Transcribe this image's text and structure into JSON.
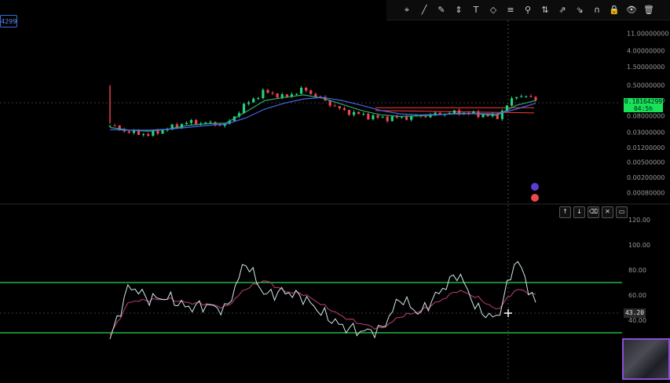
{
  "chart_data": [
    {
      "type": "line",
      "subtype": "candlestick-with-moving-averages",
      "title": "",
      "xlabel": "",
      "ylabel": "",
      "y_scale": "log",
      "ylim": [
        0.00045,
        20
      ],
      "y_ticks": [
        "11.00000000",
        "4.00000000",
        "1.50000000",
        "0.50000000",
        "0.20000000",
        "0.08000000",
        "0.03000000",
        "0.01200000",
        "0.00500000",
        "0.00200000",
        "0.00080000"
      ],
      "x": [
        0,
        6,
        12,
        18,
        24,
        30,
        36,
        42,
        48,
        54,
        60,
        66,
        72,
        78,
        84,
        90,
        96,
        102,
        108,
        114,
        120,
        126,
        132
      ],
      "series": [
        {
          "values": [
            0.045,
            0.03,
            0.026,
            0.038,
            0.055,
            0.052,
            0.046,
            0.16,
            0.35,
            0.24,
            0.4,
            0.21,
            0.11,
            0.085,
            0.07,
            0.072,
            0.078,
            0.09,
            0.1,
            0.088,
            0.075,
            0.28,
            0.22
          ]
        },
        {
          "values": [
            0.04,
            0.034,
            0.032,
            0.036,
            0.045,
            0.05,
            0.052,
            0.1,
            0.2,
            0.24,
            0.28,
            0.23,
            0.16,
            0.11,
            0.085,
            0.077,
            0.08,
            0.086,
            0.093,
            0.09,
            0.083,
            0.15,
            0.2
          ]
        },
        {
          "values": [
            0.035,
            0.034,
            0.034,
            0.036,
            0.04,
            0.045,
            0.049,
            0.07,
            0.12,
            0.17,
            0.22,
            0.24,
            0.2,
            0.15,
            0.11,
            0.09,
            0.085,
            0.087,
            0.09,
            0.092,
            0.09,
            0.12,
            0.17
          ]
        }
      ],
      "current_price": "0.18164299",
      "countdown": "04:5h",
      "horizontal_levels": [
        0.13,
        0.11
      ]
    },
    {
      "type": "line",
      "subtype": "rsi",
      "title": "",
      "xlabel": "",
      "ylabel": "",
      "ylim": [
        20,
        125
      ],
      "y_ticks": [
        "120.00",
        "100.00",
        "80.00",
        "60.00",
        "40.00"
      ],
      "bands": [
        70,
        30
      ],
      "x": [
        0,
        6,
        12,
        18,
        24,
        30,
        36,
        42,
        48,
        54,
        60,
        66,
        72,
        78,
        84,
        90,
        96,
        102,
        108,
        114,
        120,
        126,
        132
      ],
      "series": [
        {
          "values": [
            25,
            68,
            57,
            58,
            50,
            52,
            48,
            87,
            60,
            63,
            58,
            45,
            35,
            31,
            32,
            58,
            45,
            62,
            78,
            48,
            41,
            90,
            52
          ]
        },
        {
          "values": [
            28,
            55,
            56,
            57,
            54,
            53,
            50,
            65,
            72,
            63,
            61,
            52,
            43,
            37,
            33,
            43,
            47,
            55,
            64,
            58,
            48,
            65,
            60
          ]
        }
      ],
      "current_value": "43.20"
    }
  ],
  "toolbar": {
    "icons": [
      "crosshair-icon",
      "trendline-icon",
      "brush-icon",
      "measure-icon",
      "text-icon",
      "pattern-icon",
      "fib-icon",
      "pin-icon",
      "arrows-icon",
      "long-position-icon",
      "short-position-icon",
      "magnet-icon",
      "lock-icon",
      "hide-icon",
      "trash-icon"
    ]
  },
  "symbol_tag": "4299",
  "pane_controls": [
    "↑",
    "↓",
    "⌫",
    "✕",
    "▭"
  ],
  "colors": {
    "up": "#26d07c",
    "down": "#ef4452",
    "ma_fast": "#f2c14b",
    "ma_mid": "#2bb673",
    "ma_slow": "#4b6bff",
    "rsi": "#cfe8e8",
    "rsi_ma": "#b03a6e",
    "band": "#2bd94a",
    "level": "#ff3b3b",
    "price_tag": "#19e25a"
  }
}
